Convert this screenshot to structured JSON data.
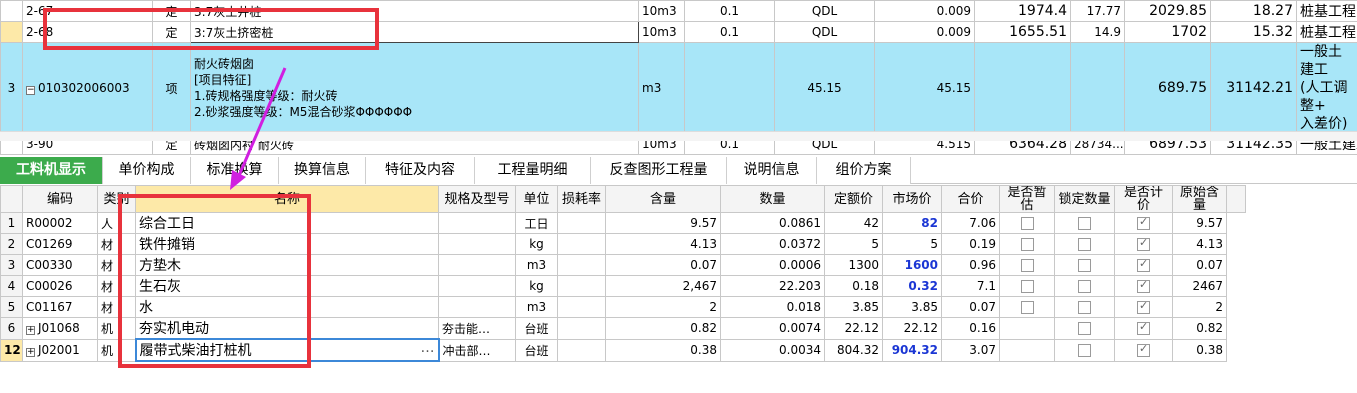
{
  "top_rows": [
    {
      "num": "",
      "code": "2-67",
      "type": "定",
      "name": "3:7灰土井桩",
      "unit": "10m3",
      "qty": "0.1",
      "qty2": "QDL",
      "a": "0.009",
      "b": "1974.4",
      "c": "17.77",
      "d": "2029.85",
      "e": "18.27",
      "f": "桩基工程(+"
    },
    {
      "num": "",
      "code": "2-68",
      "type": "定",
      "name": "3:7灰土挤密桩",
      "unit": "10m3",
      "qty": "0.1",
      "qty2": "QDL",
      "a": "0.009",
      "b": "1655.51",
      "c": "14.9",
      "d": "1702",
      "e": "15.32",
      "f": "桩基工程(+"
    },
    {
      "num": "3",
      "code": "010302006003",
      "type": "项",
      "name_lines": [
        "耐火砖烟囱",
        "[项目特征]",
        "1.砖规格强度等级：耐火砖",
        "2.砂浆强度等级：M5混合砂浆ΦΦΦΦΦΦ"
      ],
      "unit": "m3",
      "qty": "",
      "qty2": "45.15",
      "a": "45.15",
      "b": "",
      "c": "",
      "d": "689.75",
      "e": "31142.21",
      "f_lines": [
        "一般土建工",
        "(人工调整+",
        "入差价)"
      ]
    },
    {
      "num": "",
      "code": "3-90",
      "type": "定",
      "name": "砖烟囱内衬 耐火砖",
      "unit": "10m3",
      "qty": "0.1",
      "qty2": "QDL",
      "a": "4.515",
      "b": "6364.28",
      "c": "28734...",
      "d": "6897.53",
      "e": "31142.35",
      "f": "一般土建工"
    }
  ],
  "tabs": [
    "工料机显示",
    "单价构成",
    "标准换算",
    "换算信息",
    "特征及内容",
    "工程量明细",
    "反查图形工程量",
    "说明信息",
    "组价方案"
  ],
  "bottom_header": [
    "编码",
    "类别",
    "名称",
    "规格及型号",
    "单位",
    "损耗率",
    "含量",
    "数量",
    "定额价",
    "市场价",
    "合价",
    "是否暂估",
    "锁定数量",
    "是否计价",
    "原始含量"
  ],
  "bottom_rows": [
    {
      "num": "1",
      "code": "R00002",
      "type": "人",
      "name": "综合工日",
      "spec": "",
      "unit": "工日",
      "loss": "",
      "content": "9.57",
      "amount": "0.0861",
      "quota": "42",
      "market": "82",
      "market_blue": true,
      "total": "7.06",
      "est": true,
      "lock": true,
      "price": true,
      "orig": "9.57"
    },
    {
      "num": "2",
      "code": "C01269",
      "type": "材",
      "name": "铁件摊销",
      "spec": "",
      "unit": "kg",
      "loss": "",
      "content": "4.13",
      "amount": "0.0372",
      "quota": "5",
      "market": "5",
      "market_blue": false,
      "total": "0.19",
      "est": true,
      "lock": true,
      "price": true,
      "orig": "4.13"
    },
    {
      "num": "3",
      "code": "C00330",
      "type": "材",
      "name": "方垫木",
      "spec": "",
      "unit": "m3",
      "loss": "",
      "content": "0.07",
      "amount": "0.0006",
      "quota": "1300",
      "market": "1600",
      "market_blue": true,
      "total": "0.96",
      "est": true,
      "lock": true,
      "price": true,
      "orig": "0.07"
    },
    {
      "num": "4",
      "code": "C00026",
      "type": "材",
      "name": "生石灰",
      "spec": "",
      "unit": "kg",
      "loss": "",
      "content": "2,467",
      "amount": "22.203",
      "quota": "0.18",
      "market": "0.32",
      "market_blue": true,
      "total": "7.1",
      "est": true,
      "lock": true,
      "price": true,
      "orig": "2467"
    },
    {
      "num": "5",
      "code": "C01167",
      "type": "材",
      "name": "水",
      "spec": "",
      "unit": "m3",
      "loss": "",
      "content": "2",
      "amount": "0.018",
      "quota": "3.85",
      "market": "3.85",
      "market_blue": false,
      "total": "0.07",
      "est": true,
      "lock": true,
      "price": true,
      "orig": "2"
    },
    {
      "num": "6",
      "code": "J01068",
      "type": "机",
      "name": "夯实机电动",
      "spec": "夯击能…",
      "unit": "台班",
      "loss": "",
      "content": "0.82",
      "amount": "0.0074",
      "quota": "22.12",
      "market": "22.12",
      "market_blue": false,
      "total": "0.16",
      "est": false,
      "lock": true,
      "price": true,
      "orig": "0.82",
      "expand": true
    },
    {
      "num": "12",
      "code": "J02001",
      "type": "机",
      "name": "履带式柴油打桩机",
      "spec": "冲击部…",
      "unit": "台班",
      "loss": "",
      "content": "0.38",
      "amount": "0.0034",
      "quota": "804.32",
      "market": "904.32",
      "market_blue": true,
      "total": "3.07",
      "est": false,
      "lock": true,
      "price": true,
      "orig": "0.38",
      "expand": true,
      "selected": true
    }
  ]
}
